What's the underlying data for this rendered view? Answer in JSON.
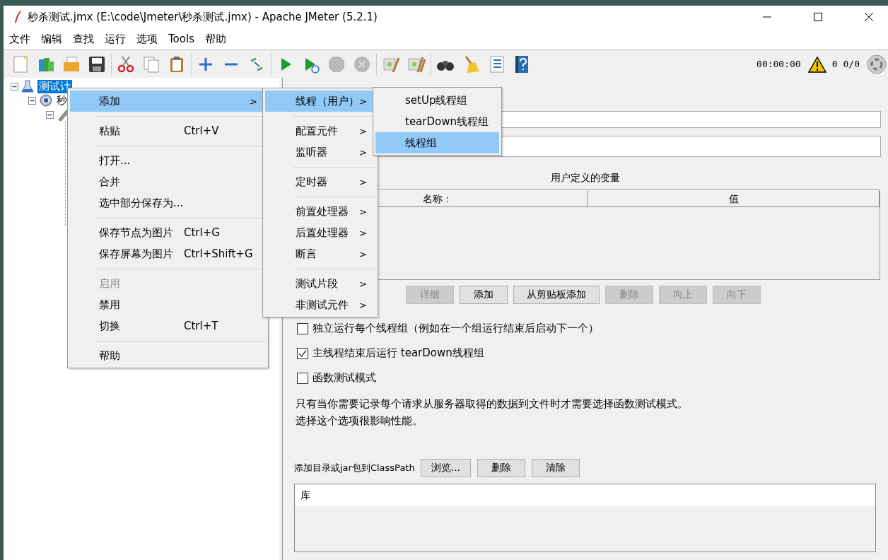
{
  "window": {
    "title": "秒杀测试.jmx (E:\\code\\Jmeter\\秒杀测试.jmx) - Apache JMeter (5.2.1)"
  },
  "menu_bar": [
    "文件",
    "编辑",
    "查找",
    "运行",
    "选项",
    "Tools",
    "帮助"
  ],
  "toolbar_status": {
    "elapsed": "00:00:00",
    "warnings": "0",
    "threads": "0/0"
  },
  "tree": [
    {
      "kind": "plan",
      "label": "测试计",
      "selected": true,
      "expanded": true,
      "children": [
        {
          "kind": "thread-group",
          "label": "秒",
          "selected": false,
          "expanded": true,
          "children": [
            {
              "kind": "sampler",
              "selected": false,
              "expanded": true
            }
          ]
        }
      ]
    }
  ],
  "variables_table": {
    "title": "用户定义的变量",
    "columns": [
      "名称：",
      "值"
    ]
  },
  "table_buttons": [
    {
      "label": "详细",
      "disabled": true
    },
    {
      "label": "添加",
      "disabled": false
    },
    {
      "label": "从剪贴板添加",
      "disabled": false
    },
    {
      "label": "删除",
      "disabled": true
    },
    {
      "label": "向上",
      "disabled": true
    },
    {
      "label": "向下",
      "disabled": true
    }
  ],
  "options": [
    {
      "label": "独立运行每个线程组（例如在一个组运行结束后启动下一个）",
      "checked": false
    },
    {
      "label": "主线程结束后运行 tearDown线程组",
      "checked": true
    },
    {
      "label": "函数测试模式",
      "checked": false
    }
  ],
  "note": [
    "只有当你需要记录每个请求从服务器取得的数据到文件时才需要选择函数测试模式。",
    "选择这个选项很影响性能。"
  ],
  "classpath": {
    "label": "添加目录或jar包到ClassPath",
    "buttons": [
      "浏览...",
      "删除",
      "清除"
    ],
    "table_header": "库"
  },
  "context_menus": [
    {
      "items": [
        {
          "kind": "item",
          "label": "添加",
          "arrow": ">",
          "selected": true,
          "disabled": false
        },
        {
          "kind": "separator"
        },
        {
          "kind": "item",
          "label": "粘贴",
          "shortcut": "Ctrl+V",
          "selected": false,
          "disabled": false
        },
        {
          "kind": "separator"
        },
        {
          "kind": "item",
          "label": "打开...",
          "selected": false,
          "disabled": false
        },
        {
          "kind": "item",
          "label": "合并",
          "selected": false,
          "disabled": false
        },
        {
          "kind": "item",
          "label": "选中部分保存为...",
          "selected": false,
          "disabled": false
        },
        {
          "kind": "separator"
        },
        {
          "kind": "item",
          "label": "保存节点为图片",
          "shortcut": "Ctrl+G",
          "selected": false,
          "disabled": false
        },
        {
          "kind": "item",
          "label": "保存屏幕为图片",
          "shortcut": "Ctrl+Shift+G",
          "selected": false,
          "disabled": false
        },
        {
          "kind": "separator"
        },
        {
          "kind": "item",
          "label": "启用",
          "selected": false,
          "disabled": true
        },
        {
          "kind": "item",
          "label": "禁用",
          "selected": false,
          "disabled": false
        },
        {
          "kind": "item",
          "label": "切换",
          "shortcut": "Ctrl+T",
          "selected": false,
          "disabled": false
        },
        {
          "kind": "separator"
        },
        {
          "kind": "item",
          "label": "帮助",
          "selected": false,
          "disabled": false
        }
      ]
    },
    {
      "items": [
        {
          "kind": "item",
          "label": "线程（用户）",
          "arrow": ">",
          "selected": true,
          "disabled": false
        },
        {
          "kind": "separator"
        },
        {
          "kind": "item",
          "label": "配置元件",
          "arrow": ">",
          "selected": false,
          "disabled": false
        },
        {
          "kind": "item",
          "label": "监听器",
          "arrow": ">",
          "selected": false,
          "disabled": false
        },
        {
          "kind": "separator"
        },
        {
          "kind": "item",
          "label": "定时器",
          "arrow": ">",
          "selected": false,
          "disabled": false
        },
        {
          "kind": "separator"
        },
        {
          "kind": "item",
          "label": "前置处理器",
          "arrow": ">",
          "selected": false,
          "disabled": false
        },
        {
          "kind": "item",
          "label": "后置处理器",
          "arrow": ">",
          "selected": false,
          "disabled": false
        },
        {
          "kind": "item",
          "label": "断言",
          "arrow": ">",
          "selected": false,
          "disabled": false
        },
        {
          "kind": "separator"
        },
        {
          "kind": "item",
          "label": "测试片段",
          "arrow": ">",
          "selected": false,
          "disabled": false
        },
        {
          "kind": "item",
          "label": "非测试元件",
          "arrow": ">",
          "selected": false,
          "disabled": false
        }
      ]
    },
    {
      "items": [
        {
          "kind": "item",
          "label": "setUp线程组",
          "selected": false,
          "disabled": false
        },
        {
          "kind": "item",
          "label": "tearDown线程组",
          "selected": false,
          "disabled": false
        },
        {
          "kind": "item",
          "label": "线程组",
          "selected": true,
          "disabled": false
        }
      ]
    }
  ]
}
